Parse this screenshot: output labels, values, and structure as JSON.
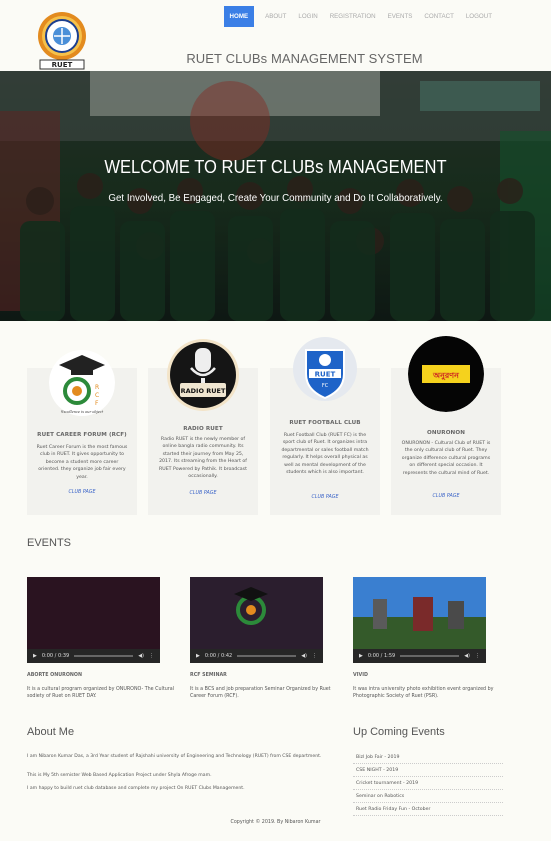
{
  "header": {
    "logo_text": "RUET",
    "site_title": "RUET CLUBs MANAGEMENT SYSTEM",
    "nav": [
      "HOME",
      "ABOUT",
      "LOGIN",
      "REGISTRATION",
      "EVENTS",
      "CONTACT",
      "LOGOUT"
    ]
  },
  "hero": {
    "title": "WELCOME TO RUET CLUBs MANAGEMENT",
    "subtitle": "Get Involved, Be Engaged, Create Your Community and Do It Collaboratively."
  },
  "clubs": [
    {
      "name": "RUET CAREER FORUM (RCF)",
      "desc": "Ruet Career Forum is the most famous club in RUET. It gives opportunity to become a student more career oriented. they organize job fair every year.",
      "link": "CLUB PAGE",
      "tagline": "Excellence is our object"
    },
    {
      "name": "RADIO RUET",
      "desc": "Radio RUET is the newly member of online bangla radio community. Its started their journey from May 25, 2017. Its streaming from the Heart of RUET Powered by Pathik. It broadcast occasionally.",
      "link": "CLUB PAGE",
      "logo_text": "RADIO RUET"
    },
    {
      "name": "RUET FOOTBALL CLUB",
      "desc": "Ruet Football Club (RUET FC) is the sport club of Ruet. It organizes intra departmental or sales football match regularly. It helps overall physical as well as mental development of the students which is also important.",
      "link": "CLUB PAGE",
      "logo_text": "RUET",
      "logo_sub": "FC"
    },
    {
      "name": "ONURONON",
      "desc": "ONURONON - Cultural Club of RUET is the only cultural club of Ruet. They organize difference cultural programs on different special occasion. It represents the cultural mind of Ruet.",
      "link": "CLUB PAGE",
      "logo_text": "অনুরণন"
    }
  ],
  "events_heading": "EVENTS",
  "events": [
    {
      "title": "ABORTE ONURONON",
      "desc": "It is a cultural program organized by ONURONO- The Cultural sodiety of Ruet on RUET DAY.",
      "time": "0:00 / 0:39"
    },
    {
      "title": "RCF SEMINAR",
      "desc": "It is a BCS and job preparation Seminar Organized by Ruet Career Forum (RCF).",
      "time": "0:00 / 0:42"
    },
    {
      "title": "VIVID",
      "desc": "It was intra university photo exhibition event organized by Photographic Society of Ruet (PSR).",
      "time": "0:00 / 1:59"
    }
  ],
  "about": {
    "heading": "About Me",
    "paragraphs": [
      "I am Nibaron Kumar Das, a 3rd Year student of Rajshahi university of Engineering and Technology (RUET) from CSE department.",
      "This is My 5th semister Web Based Application Project under Shyla Afroge mam.",
      "I am happy to build ruet club database and complete my project On RUET Clubs Management."
    ]
  },
  "upcoming": {
    "heading": "Up Coming Events",
    "items": [
      "Bizl Job Fair - 2019",
      "CSE NIGHT - 2019",
      "Cricket tournament - 2019",
      "Seminar on Robotics",
      "Ruet Radio Friday Fun - October"
    ]
  },
  "footer": "Copyright © 2019. By Nibaron Kumar"
}
